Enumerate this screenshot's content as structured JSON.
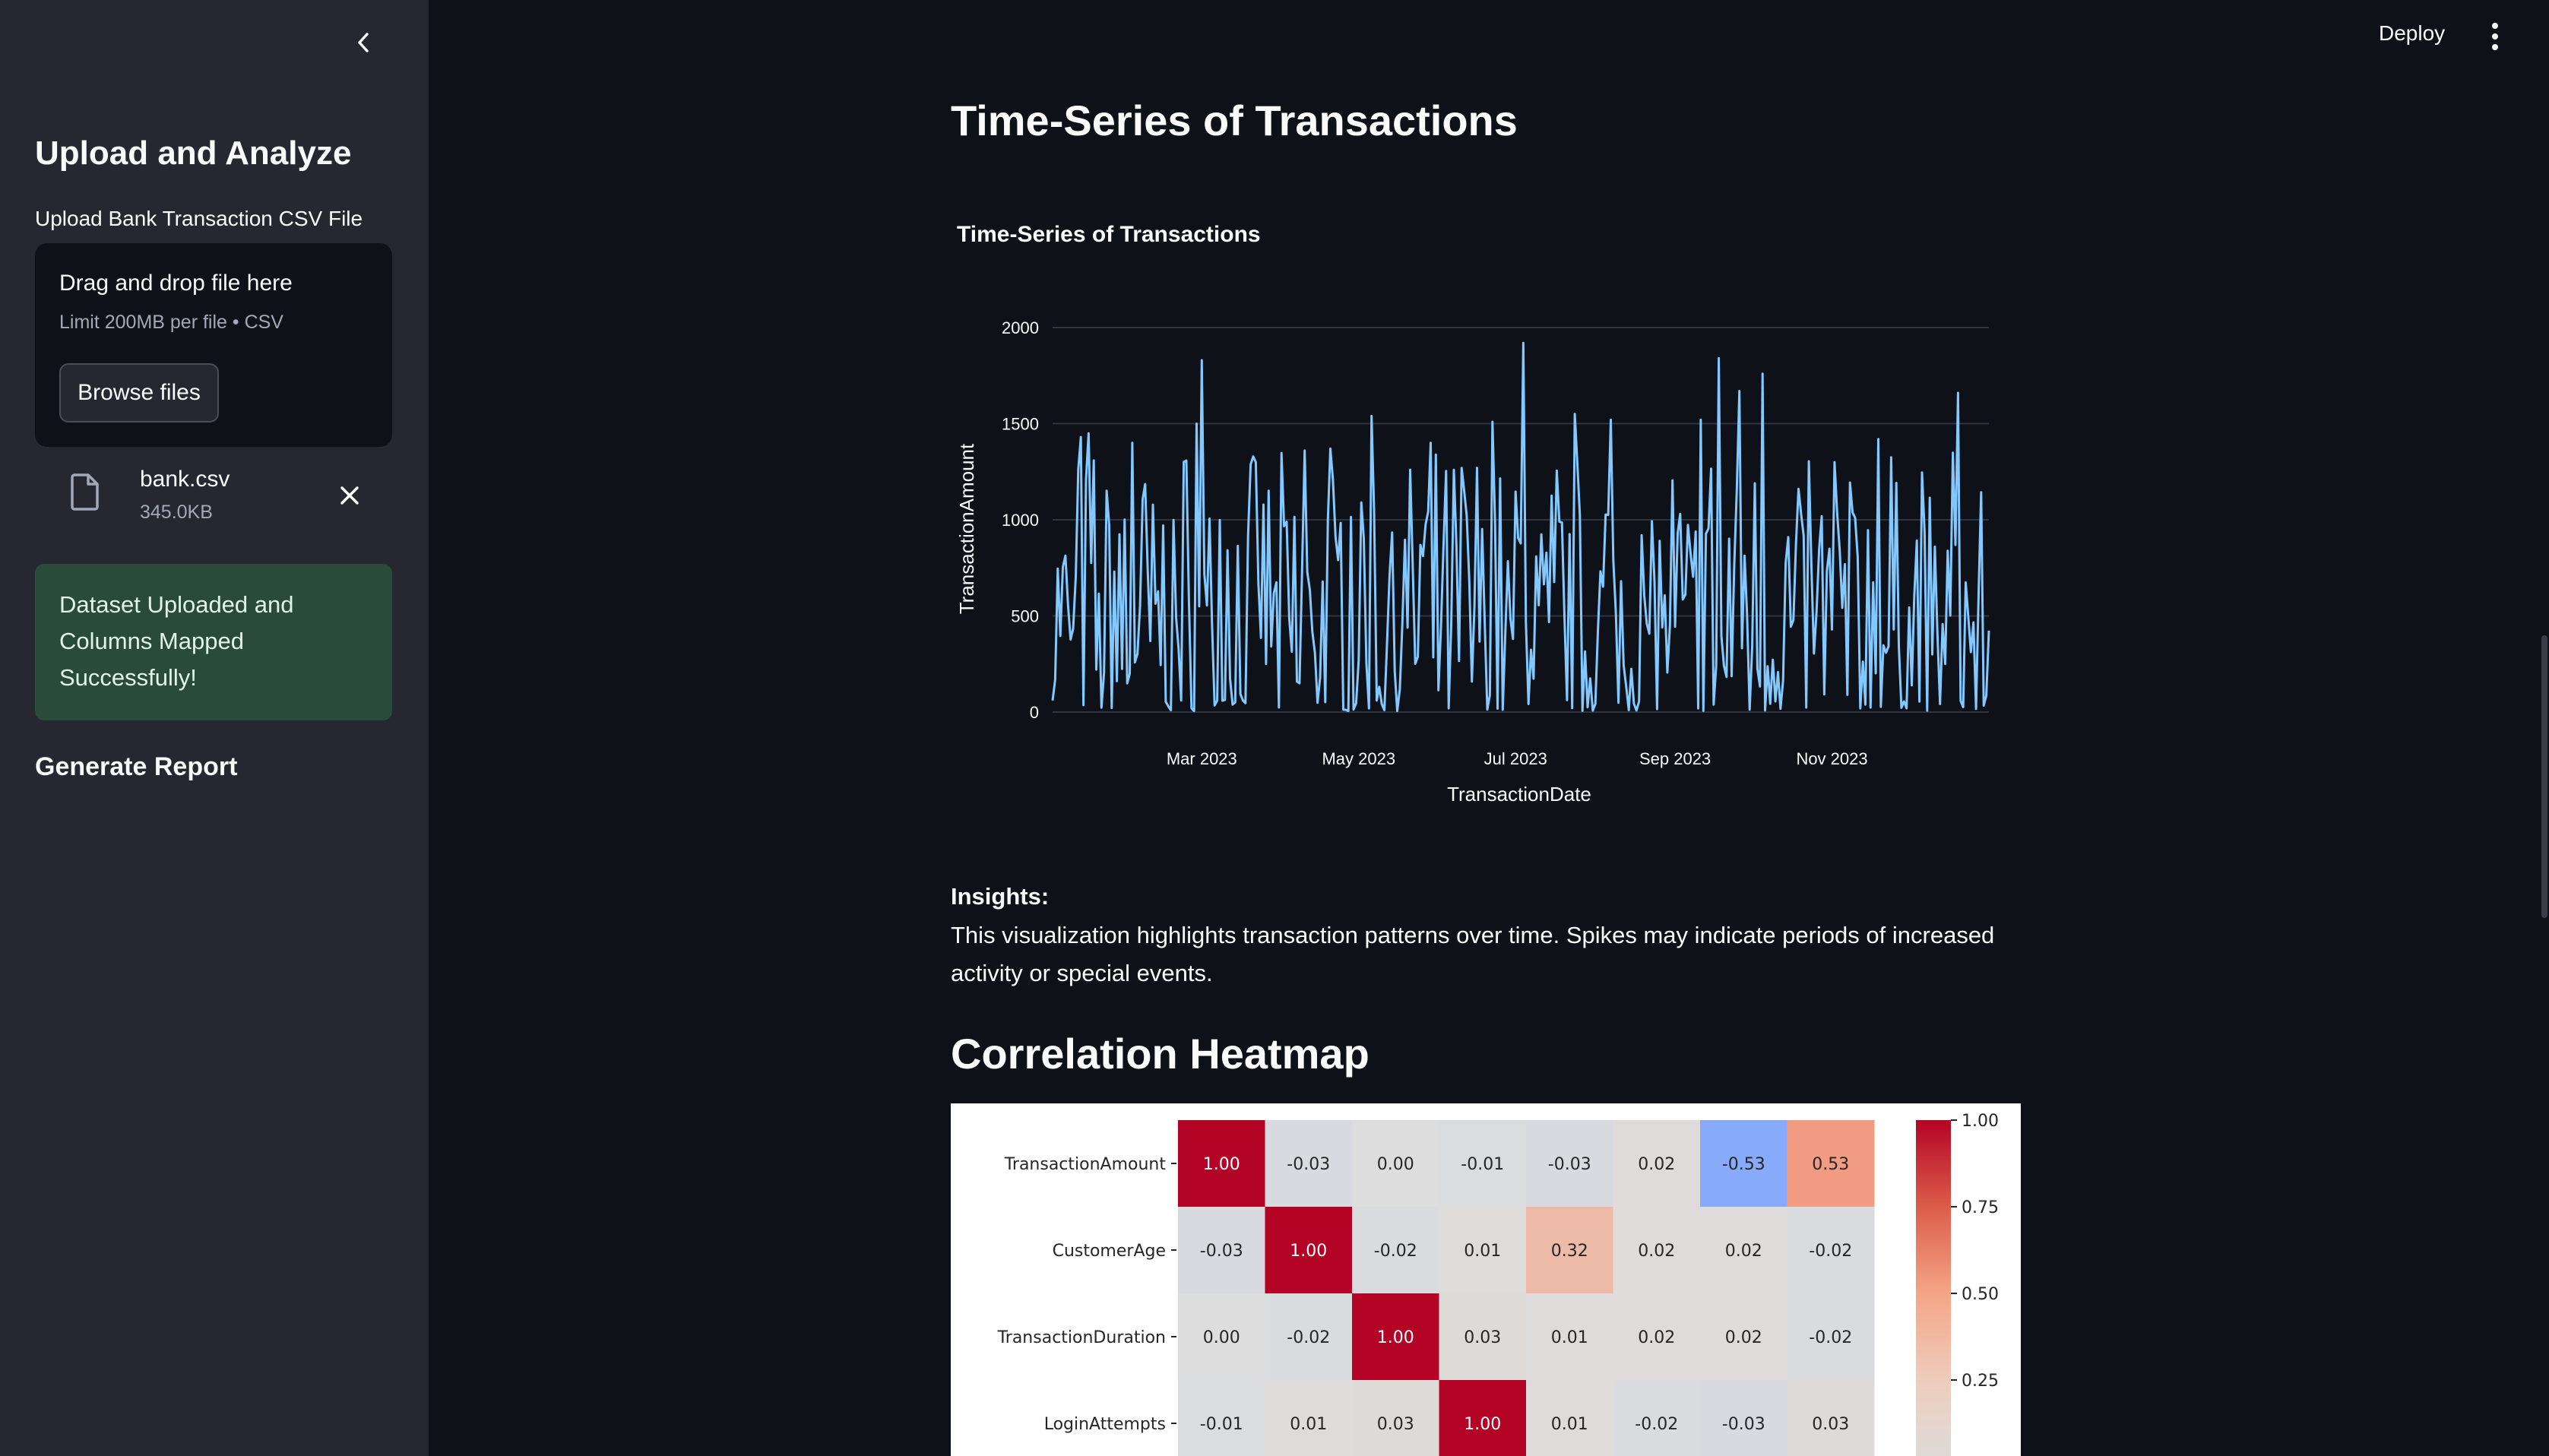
{
  "sidebar": {
    "title": "Upload and Analyze",
    "upload_label": "Upload Bank Transaction CSV File",
    "dropzone": {
      "main": "Drag and drop file here",
      "sub": "Limit 200MB per file • CSV",
      "browse": "Browse files"
    },
    "file": {
      "name": "bank.csv",
      "size": "345.0KB"
    },
    "success_message": "Dataset Uploaded and Columns Mapped Successfully!",
    "report_heading": "Generate Report"
  },
  "header": {
    "deploy_label": "Deploy"
  },
  "main": {
    "timeseries_heading": "Time-Series of Transactions",
    "insights_title": "Insights:",
    "insights_text": "This visualization highlights transaction patterns over time. Spikes may indicate periods of increased activity or special events.",
    "heatmap_heading": "Correlation Heatmap"
  },
  "colors": {
    "line": "#83c9ff",
    "sidebar_bg": "#262730",
    "app_bg": "#0e1117",
    "success_bg": "#2a4a3a"
  },
  "chart_data": [
    {
      "type": "line",
      "title": "Time-Series of Transactions",
      "xlabel": "TransactionDate",
      "ylabel": "TransactionAmount",
      "ylim": [
        0,
        2000
      ],
      "xlim": [
        "2023-01-02",
        "2024-01-01"
      ],
      "yticks": [
        0,
        500,
        1000,
        1500,
        2000
      ],
      "xticks": [
        {
          "date": "2023-03-01",
          "label": "Mar 2023"
        },
        {
          "date": "2023-05-01",
          "label": "May 2023"
        },
        {
          "date": "2023-07-01",
          "label": "Jul 2023"
        },
        {
          "date": "2023-09-01",
          "label": "Sep 2023"
        },
        {
          "date": "2023-11-01",
          "label": "Nov 2023"
        }
      ],
      "grid": true,
      "peaks": [
        {
          "date": "2023-01-13",
          "y": 1430
        },
        {
          "date": "2023-01-16",
          "y": 1450
        },
        {
          "date": "2023-02-02",
          "y": 1400
        },
        {
          "date": "2023-02-27",
          "y": 1500
        },
        {
          "date": "2023-03-01",
          "y": 1830
        },
        {
          "date": "2023-03-22",
          "y": 1300
        },
        {
          "date": "2023-04-10",
          "y": 1360
        },
        {
          "date": "2023-04-20",
          "y": 1370
        },
        {
          "date": "2023-05-06",
          "y": 1540
        },
        {
          "date": "2023-05-29",
          "y": 1400
        },
        {
          "date": "2023-06-10",
          "y": 1270
        },
        {
          "date": "2023-06-22",
          "y": 1510
        },
        {
          "date": "2023-07-04",
          "y": 1920
        },
        {
          "date": "2023-07-24",
          "y": 1550
        },
        {
          "date": "2023-08-07",
          "y": 1520
        },
        {
          "date": "2023-09-11",
          "y": 1520
        },
        {
          "date": "2023-09-18",
          "y": 1840
        },
        {
          "date": "2023-09-26",
          "y": 1670
        },
        {
          "date": "2023-10-05",
          "y": 1760
        },
        {
          "date": "2023-11-02",
          "y": 1300
        },
        {
          "date": "2023-11-19",
          "y": 1420
        },
        {
          "date": "2023-12-20",
          "y": 1660
        }
      ]
    },
    {
      "type": "heatmap",
      "title": "",
      "labels": [
        "TransactionAmount",
        "CustomerAge",
        "TransactionDuration",
        "LoginAttempts"
      ],
      "values": [
        [
          1.0,
          -0.03,
          0.0,
          -0.01,
          -0.03,
          0.02,
          -0.53,
          0.53
        ],
        [
          -0.03,
          1.0,
          -0.02,
          0.01,
          0.32,
          0.02,
          0.02,
          -0.02
        ],
        [
          0.0,
          -0.02,
          1.0,
          0.03,
          0.01,
          0.02,
          0.02,
          -0.02
        ],
        [
          -0.01,
          0.01,
          0.03,
          1.0,
          0.01,
          -0.02,
          -0.03,
          0.03
        ]
      ],
      "colorbar_ticks": [
        "1.00",
        "0.75",
        "0.50",
        "0.25"
      ],
      "colormap": "coolwarm"
    }
  ]
}
